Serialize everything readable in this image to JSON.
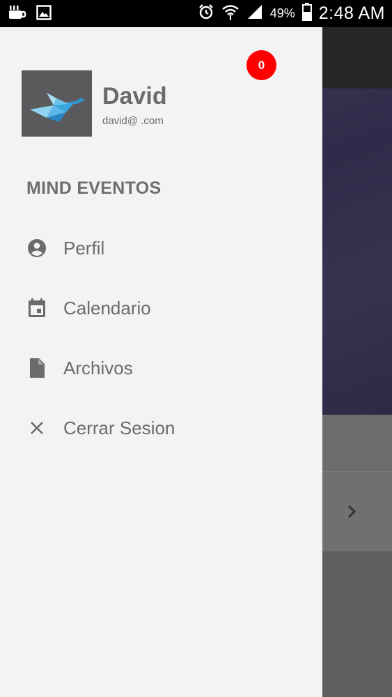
{
  "status_bar": {
    "battery_percent": "49%",
    "time": "2:48 AM",
    "icons": [
      "cup-icon",
      "image-icon",
      "alarm-icon",
      "wifi-icon",
      "signal-icon",
      "battery-icon"
    ]
  },
  "drawer": {
    "notification_count": "0",
    "user": {
      "name": "David",
      "email": "david@ .com"
    },
    "section_title": "MIND EVENTOS",
    "menu": [
      {
        "label": "Perfil",
        "icon": "account-circle-icon"
      },
      {
        "label": "Calendario",
        "icon": "calendar-icon"
      },
      {
        "label": "Archivos",
        "icon": "file-icon"
      },
      {
        "label": "Cerrar Sesion",
        "icon": "close-icon"
      }
    ]
  },
  "colors": {
    "drawer_bg": "#f3f3f5",
    "badge": "#ff0000",
    "text": "#6b6b6b",
    "scrim": "#5f5f61"
  }
}
